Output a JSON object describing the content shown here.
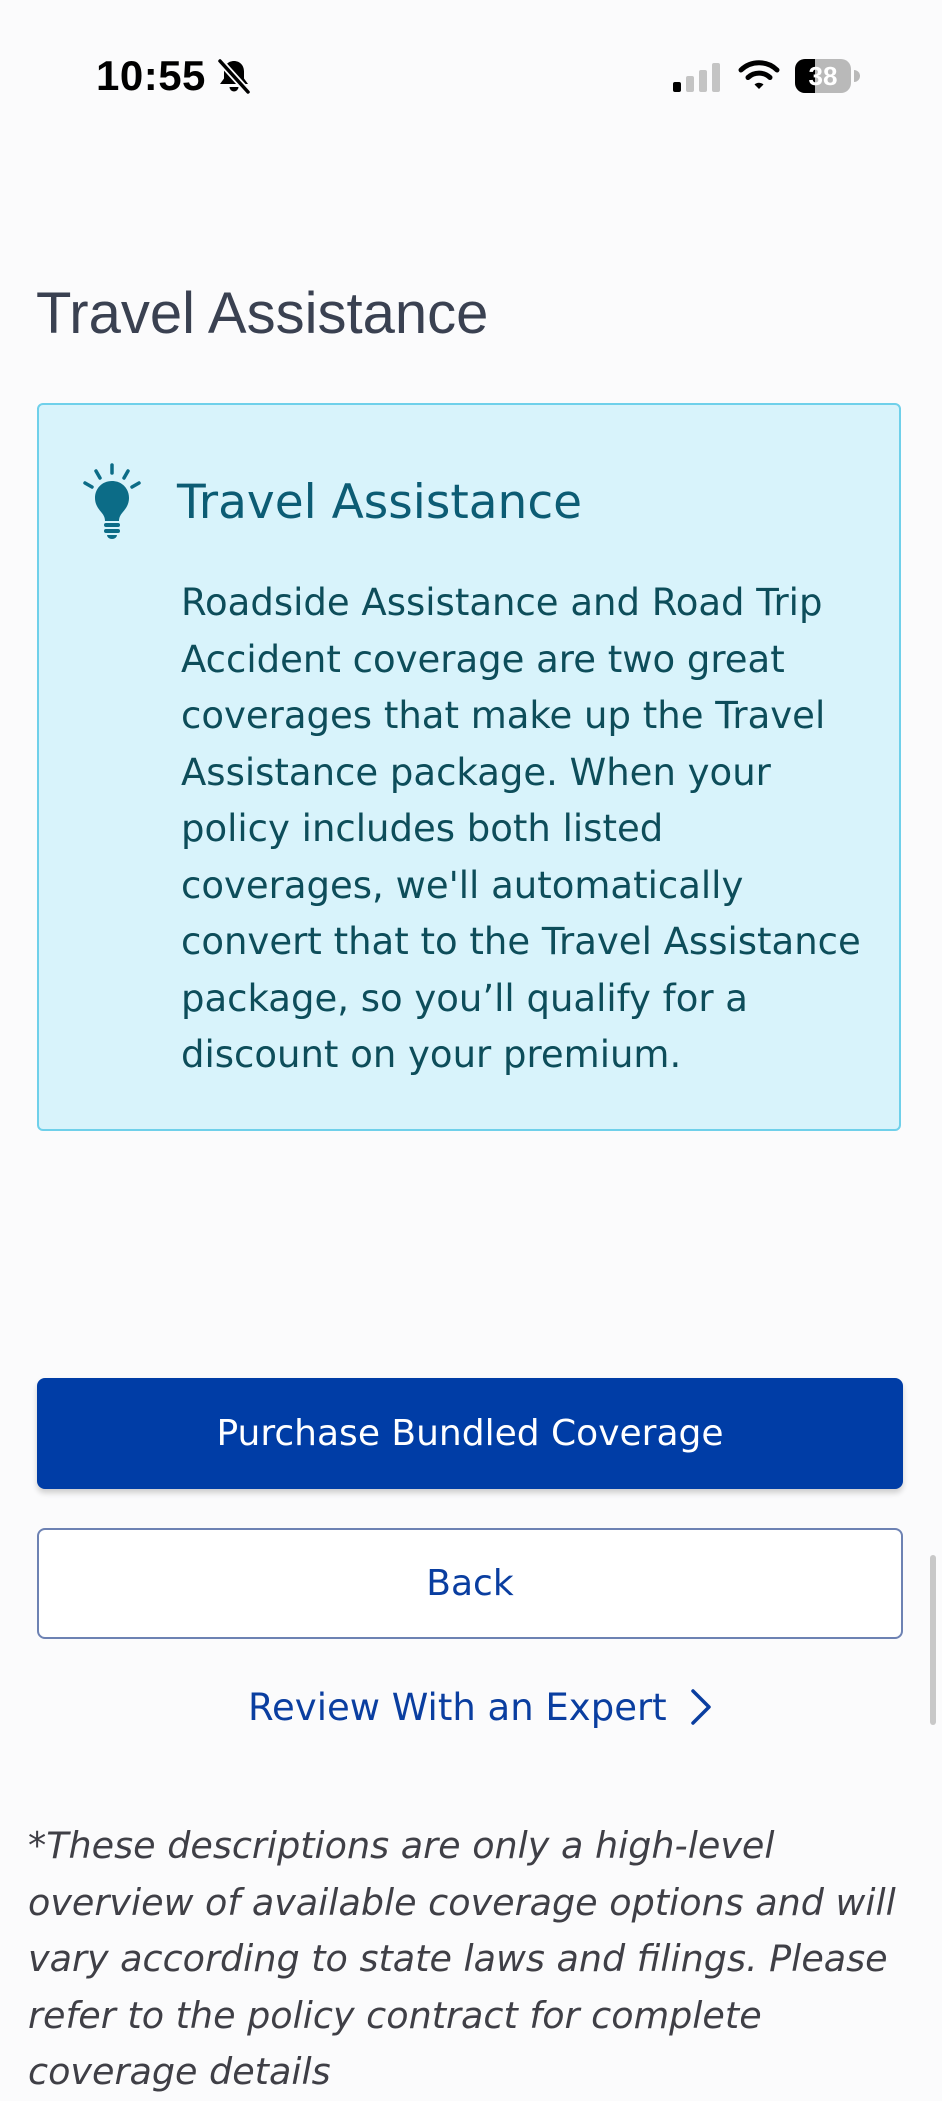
{
  "status_bar": {
    "time": "10:55",
    "battery": "38",
    "icons": [
      "bell-slash-icon",
      "cellular-signal-icon",
      "wifi-icon",
      "battery-icon"
    ]
  },
  "page": {
    "title": "Travel Assistance"
  },
  "tip": {
    "icon": "lightbulb-icon",
    "title": "Travel Assistance",
    "body": "Roadside Assistance and Road Trip Accident coverage are two great coverages that make up the Travel Assistance package. When your policy includes both listed coverages, we'll automatically convert that to the Travel Assistance package, so you’ll qualify for a discount on your premium."
  },
  "actions": {
    "purchase_label": "Purchase Bundled Coverage",
    "back_label": "Back",
    "expert_label": "Review With an Expert"
  },
  "disclaimer": "*These descriptions are only a high-level overview of available coverage options and will vary according to state laws and filings. Please refer to the policy contract for complete coverage details",
  "colors": {
    "primary": "#003da6",
    "tip_background": "#d8f3fb",
    "tip_border": "#6fd0ea",
    "tip_text": "#0c5c74"
  }
}
